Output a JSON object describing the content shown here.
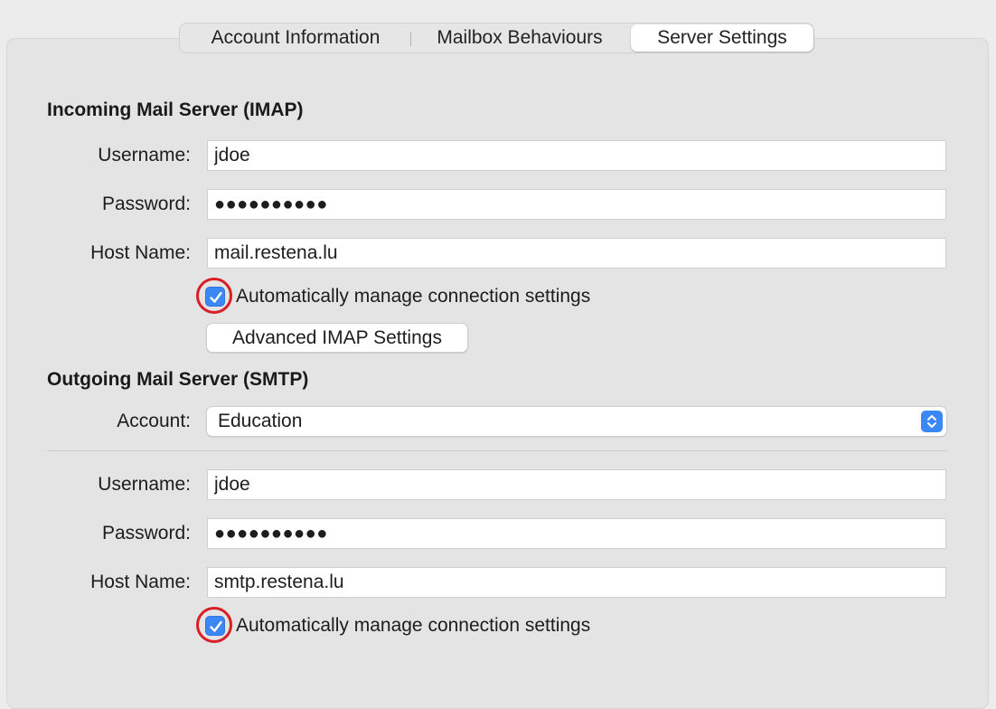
{
  "tabs": [
    {
      "label": "Account Information",
      "selected": false
    },
    {
      "label": "Mailbox Behaviours",
      "selected": false
    },
    {
      "label": "Server Settings",
      "selected": true
    }
  ],
  "incoming": {
    "title": "Incoming Mail Server (IMAP)",
    "username_label": "Username:",
    "username_value": "jdoe",
    "password_label": "Password:",
    "password_value": "●●●●●●●●●●",
    "host_label": "Host Name:",
    "host_value": "mail.restena.lu",
    "auto_manage_label": "Automatically manage connection settings",
    "auto_manage_checked": true,
    "advanced_button": "Advanced IMAP Settings"
  },
  "outgoing": {
    "title": "Outgoing Mail Server (SMTP)",
    "account_label": "Account:",
    "account_value": "Education",
    "username_label": "Username:",
    "username_value": "jdoe",
    "password_label": "Password:",
    "password_value": "●●●●●●●●●●",
    "host_label": "Host Name:",
    "host_value": "smtp.restena.lu",
    "auto_manage_label": "Automatically manage connection settings",
    "auto_manage_checked": true
  },
  "colors": {
    "accent": "#3b87f5",
    "highlight_ring": "#d81f26",
    "panel": "#e4e4e4",
    "window": "#ececec"
  },
  "icons": {
    "checkbox": "checkmark-icon",
    "popup": "up-down-chevron-icon"
  }
}
